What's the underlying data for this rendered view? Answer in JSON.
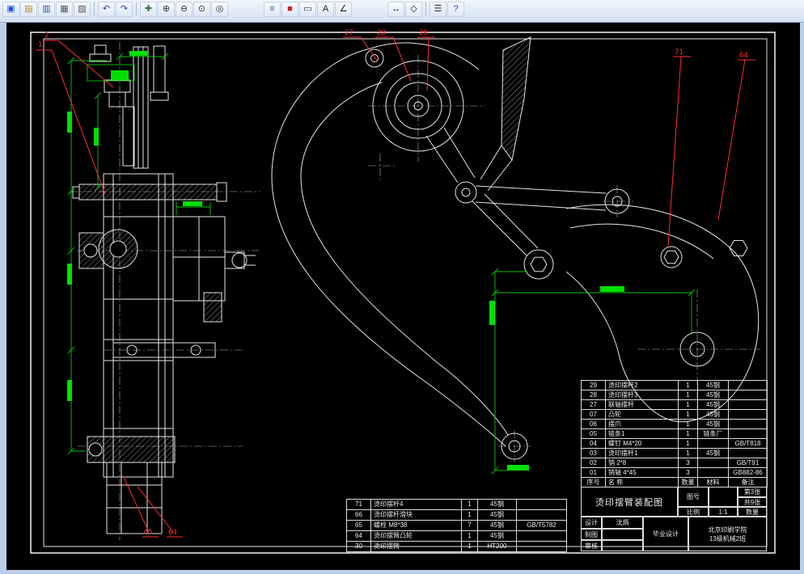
{
  "colors": {
    "line": "#e6e6e6",
    "dimension": "#00c800",
    "dimension_text": "#00e000",
    "callout": "#ff2f2f",
    "canvas_bg": "#000000",
    "toolbar_bg": "#dce8f5"
  },
  "toolbar": {
    "icons": [
      {
        "name": "app-window",
        "glyph": "▣",
        "color": "#1a4fd6"
      },
      {
        "name": "open-file",
        "glyph": "▤",
        "color": "#b08a1e"
      },
      {
        "name": "save-file",
        "glyph": "▥",
        "color": "#33549e"
      },
      {
        "name": "print",
        "glyph": "▦",
        "color": "#555555"
      },
      {
        "name": "print-preview",
        "glyph": "▧",
        "color": "#555555"
      },
      {
        "name": "separator"
      },
      {
        "name": "undo",
        "glyph": "↶",
        "color": "#2244cc"
      },
      {
        "name": "redo",
        "glyph": "↷",
        "color": "#2244cc"
      },
      {
        "name": "separator"
      },
      {
        "name": "pan",
        "glyph": "✚",
        "color": "#3a7a3a"
      },
      {
        "name": "zoom-in",
        "glyph": "⊕",
        "color": "#333333"
      },
      {
        "name": "zoom-out",
        "glyph": "⊖",
        "color": "#333333"
      },
      {
        "name": "zoom-window",
        "glyph": "⊙",
        "color": "#333333"
      },
      {
        "name": "zoom-extents",
        "glyph": "◎",
        "color": "#333333"
      },
      {
        "name": "gap"
      },
      {
        "name": "layers",
        "glyph": "≡",
        "color": "#7c3f9e"
      },
      {
        "name": "color-control",
        "glyph": "■",
        "color": "#cc2222"
      },
      {
        "name": "linetype",
        "glyph": "▭",
        "color": "#333333"
      },
      {
        "name": "text-style",
        "glyph": "A",
        "color": "#222222"
      },
      {
        "name": "dimension-style",
        "glyph": "∠",
        "color": "#222222"
      },
      {
        "name": "gap"
      },
      {
        "name": "measure-distance",
        "glyph": "↔",
        "color": "#222222"
      },
      {
        "name": "measure-area",
        "glyph": "◇",
        "color": "#222222"
      },
      {
        "name": "separator"
      },
      {
        "name": "properties",
        "glyph": "☰",
        "color": "#333333"
      },
      {
        "name": "help",
        "glyph": "?",
        "color": "#2244cc"
      }
    ]
  },
  "callouts": {
    "n1": "1",
    "n2": "2",
    "n27": "27",
    "n28": "28",
    "n29": "29",
    "n71": "71",
    "n64_top": "64",
    "n65": "65",
    "n64_bottom": "64"
  },
  "bom_right": {
    "headers": [
      "序号",
      "名  称",
      "数量",
      "材料",
      "备注"
    ],
    "rows": [
      [
        "29",
        "烫印摆杆2",
        "1",
        "45钢",
        ""
      ],
      [
        "28",
        "烫印摆杆3",
        "1",
        "45钢",
        ""
      ],
      [
        "27",
        "联轴摆杆",
        "1",
        "45钢",
        ""
      ],
      [
        "07",
        "凸轮",
        "1",
        "45钢",
        ""
      ],
      [
        "06",
        "摆爪",
        "1",
        "45钢",
        ""
      ],
      [
        "05",
        "链条1",
        "1",
        "链条厂",
        ""
      ],
      [
        "04",
        "螺钉 M4*20",
        "1",
        "",
        "GB/T818"
      ],
      [
        "03",
        "烫印摆杆1",
        "1",
        "45钢",
        ""
      ],
      [
        "02",
        "销 2*8",
        "3",
        "",
        "GB/T91"
      ],
      [
        "01",
        "销轴 4*45",
        "3",
        "",
        "GB882-86"
      ]
    ]
  },
  "bom_left": {
    "rows": [
      [
        "71",
        "烫印摆杆4",
        "1",
        "45钢",
        ""
      ],
      [
        "66",
        "烫印摆杆滑块",
        "1",
        "45钢",
        ""
      ],
      [
        "65",
        "螺栓 M8*38",
        "7",
        "45钢",
        "GB/T5782"
      ],
      [
        "64",
        "烫印摆臂凸轮",
        "1",
        "45钢",
        ""
      ],
      [
        "30",
        "烫印摆臂",
        "1",
        "HT200",
        ""
      ]
    ]
  },
  "title_block": {
    "drawing_title": "烫印摆臂装配图",
    "fig_no_label": "图号",
    "sheet_top": "第3张",
    "sheet_bottom": "共9张",
    "scale_label": "比例",
    "scale_value": "1:1",
    "qty_label": "数量",
    "designer_label": "设计",
    "designer_value": "沈炳",
    "draft_label": "制图",
    "check_label": "审核",
    "project": "毕业设计",
    "school_line1": "北京印刷学院",
    "school_line2": "13级机械2班"
  }
}
